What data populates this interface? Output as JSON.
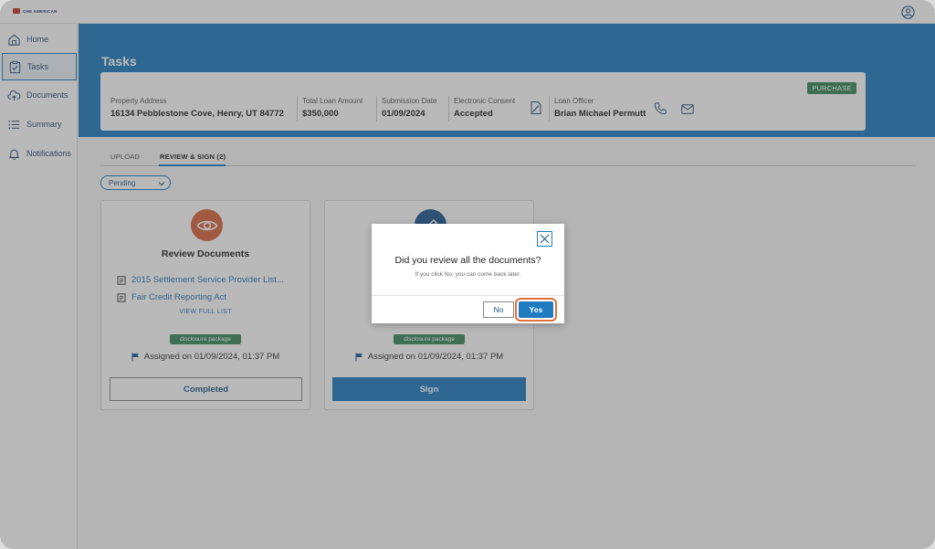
{
  "colors": {
    "accent": "#1f7bc0",
    "badge_green": "#3a8a5c",
    "review_icon_bg": "#d9673e",
    "highlight": "#e0703a"
  },
  "header": {
    "logo_text": "ONE AMERICAN",
    "user_icon": "user-circle-icon"
  },
  "sidebar": {
    "items": [
      {
        "label": "Home",
        "icon": "home-icon"
      },
      {
        "label": "Tasks",
        "icon": "tasks-icon",
        "active": true
      },
      {
        "label": "Documents",
        "icon": "cloud-upload-icon"
      },
      {
        "label": "Summary",
        "icon": "list-icon"
      },
      {
        "label": "Notifications",
        "icon": "bell-icon"
      }
    ]
  },
  "page": {
    "title": "Tasks"
  },
  "loan": {
    "badge": "PURCHASE",
    "property_address_label": "Property Address",
    "property_address": "16134 Pebblestone Cove, Henry, UT 84772",
    "total_loan_label": "Total Loan Amount",
    "total_loan": "$350,000",
    "submission_label": "Submission Date",
    "submission_date": "01/09/2024",
    "consent_label": "Electronic Consent",
    "consent_value": "Accepted",
    "officer_label": "Loan Officer",
    "officer_name": "Brian Michael Permutt"
  },
  "tabs": [
    {
      "label": "UPLOAD"
    },
    {
      "label": "REVIEW & SIGN (2)",
      "active": true
    }
  ],
  "filter": {
    "value": "Pending"
  },
  "cards": [
    {
      "title": "Review Documents",
      "icon": "eye-icon",
      "docs": [
        "2015 Settlement Service Provider List...",
        "Fair Credit Reporting Act"
      ],
      "view_full": "VIEW FULL LIST",
      "badge": "disclosure package",
      "assigned": "Assigned on 01/09/2024, 01:37 PM",
      "button": "Completed"
    },
    {
      "icon": "pen-icon",
      "badge": "disclosure package",
      "assigned": "Assigned on 01/09/2024, 01:37 PM",
      "button": "Sign"
    }
  ],
  "modal": {
    "question": "Did you review all the documents?",
    "subtext": "If you click No, you can come back later.",
    "no_label": "No",
    "yes_label": "Yes"
  }
}
